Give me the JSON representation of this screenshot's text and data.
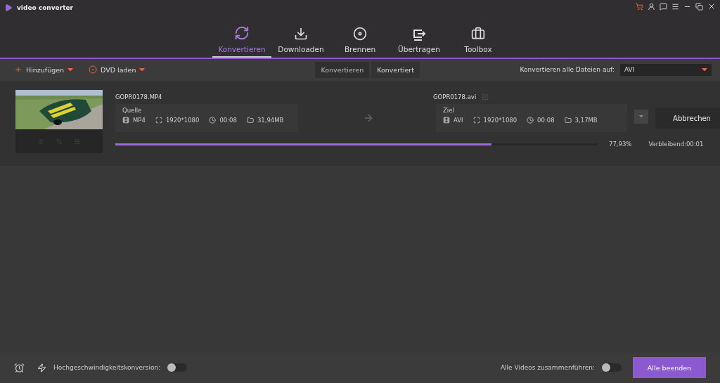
{
  "app": {
    "title": "video converter"
  },
  "nav_tabs": [
    {
      "label": "Konvertieren",
      "selected": true,
      "kind": "convert"
    },
    {
      "label": "Downloaden",
      "selected": false,
      "kind": "download"
    },
    {
      "label": "Brennen",
      "selected": false,
      "kind": "burn"
    },
    {
      "label": "Übertragen",
      "selected": false,
      "kind": "transfer"
    },
    {
      "label": "Toolbox",
      "selected": false,
      "kind": "toolbox"
    }
  ],
  "toolbar": {
    "add_label": "Hinzufügen",
    "dvd_label": "DVD laden",
    "sub_tabs": [
      {
        "label": "Konvertieren",
        "selected": true
      },
      {
        "label": "Konvertiert",
        "selected": false
      }
    ],
    "output_label": "Konvertieren alle Dateien auf:",
    "output_format": "AVI"
  },
  "file": {
    "source_name": "GOPR0178.MP4",
    "target_name": "GOPR0178.avi",
    "source": {
      "heading": "Quelle",
      "format": "MP4",
      "resolution": "1920*1080",
      "duration": "00:08",
      "size": "31,94MB"
    },
    "target": {
      "heading": "Ziel",
      "format": "AVI",
      "resolution": "1920*1080",
      "duration": "00:08",
      "size": "3,17MB"
    },
    "cancel_label": "Abbrechen",
    "progress": {
      "level": 0.7793,
      "percent": "77,93%",
      "remaining": "Verbleibend:00:01"
    }
  },
  "footer": {
    "speed_label": "Hochgeschwindigkeitskonversion:",
    "speed_on": false,
    "merge_label": "Alle Videos zusammenführen:",
    "merge_on": false,
    "finish_label": "Alle beenden"
  }
}
